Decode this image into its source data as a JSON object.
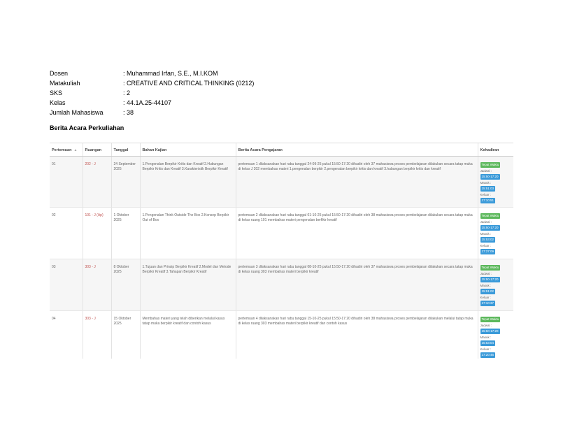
{
  "info": [
    {
      "key": "Dosen",
      "value": ": Muhammad Irfan, S.E., M.I.KOM"
    },
    {
      "key": "Matakuliah",
      "value": ": CREATIVE AND CRITICAL THINKING (0212)"
    },
    {
      "key": "SKS",
      "value": ": 2"
    },
    {
      "key": "Kelas",
      "value": ": 44.1A.25-44107"
    },
    {
      "key": "Jumlah Mahasiswa",
      "value": ": 38"
    }
  ],
  "section_title": "Berita Acara Perkuliahan",
  "table": {
    "headers": [
      "Pertemuan",
      "Ruangan",
      "Tanggal",
      "Bahan Kajian",
      "Berita Acara Pengajaran",
      "Kehadiran"
    ],
    "sort_glyph": "▲",
    "kehadiran_labels": {
      "status": "Tepat Waktu",
      "jadwal": "Jadwal :",
      "masuk": "Masuk :",
      "keluar": "Keluar :"
    },
    "rows": [
      {
        "pertemuan": "01",
        "ruangan": "202 - J",
        "tanggal": "24 September 2025",
        "bahan": "1.Pengenalan Berpikir Kritis dan Kreatif 2.Hubungan Berpikir Kritis dan Kreatif 3.Karakteristik Berpikir Kreatif",
        "berita": "pertemuan 1 dilaksanakan hari rabu tanggal 24-09-25 pukul 15:50-17:20 dihadiri oleh 37 mahasiswa proses pembelajaran dilakukan secara tatap muka di kelas J 202 membahas materi 1.pengenalan berpikir 2.pengenalan berpikir kritis dan kreatif 3.hubungan berpikir kritis dan kreatif",
        "jadwal": "15:50-17:20",
        "masuk": "15:51:03",
        "keluar": "17:10:51"
      },
      {
        "pertemuan": "02",
        "ruangan": "101 - J (Ap)",
        "tanggal": "1 Oktober 2025",
        "bahan": "1.Pengenalan Think Outside The Box 2.Konsep Berpikir Out of Box",
        "berita": "pertemuan 2 dilaksanakan hari rabu tanggal 01-10-25 pukul 15:50-17:20 dihadiri oleh 38 mahasiswa proses pembelajaran dilakukan secara tatap muka di kelas ruang 101 membahas materi pengenalan berfikir kreatif",
        "jadwal": "15:50-17:20",
        "masuk": "15:53:02",
        "keluar": "17:27:09"
      },
      {
        "pertemuan": "03",
        "ruangan": "303 - J",
        "tanggal": "8 Oktober 2025",
        "bahan": "1.Tujuan dan Prinsip Berpikir Kreatif 2.Model dan Metode Berpikir Kreatif 3.Tahapan Berpikir Kreatif",
        "berita": "pertemuan 3 dilaksanakan hari rabu tanggal 08-10-25 pukul 15:50-17:20 dihadiri oleh 37 mahasiswa proses pembelajaran dilakukan secara tatap muka di kelas ruang 303 membahas materi berpikir kreatif",
        "jadwal": "15:50-17:20",
        "masuk": "15:51:02",
        "keluar": "17:10:37"
      },
      {
        "pertemuan": "04",
        "ruangan": "303 - J",
        "tanggal": "15 Oktober 2025",
        "bahan": "Membahas materi yang telah diberikan melalui kasus tatap muka berpikir kreatif dan contoh kasus",
        "berita": "pertemuan 4 dilaksanakan hari rabu tanggal 15-10-25 pukul 15:50-17:20 dihadiri oleh 38 mahasiswa proses pembelajaran dilakukan melalui tatap muka di kelas ruang 303 membahas materi berpikir kreatif dan contoh kasus",
        "jadwal": "15:50-17:20",
        "masuk": "15:53:04",
        "keluar": "17:20:46"
      }
    ]
  }
}
